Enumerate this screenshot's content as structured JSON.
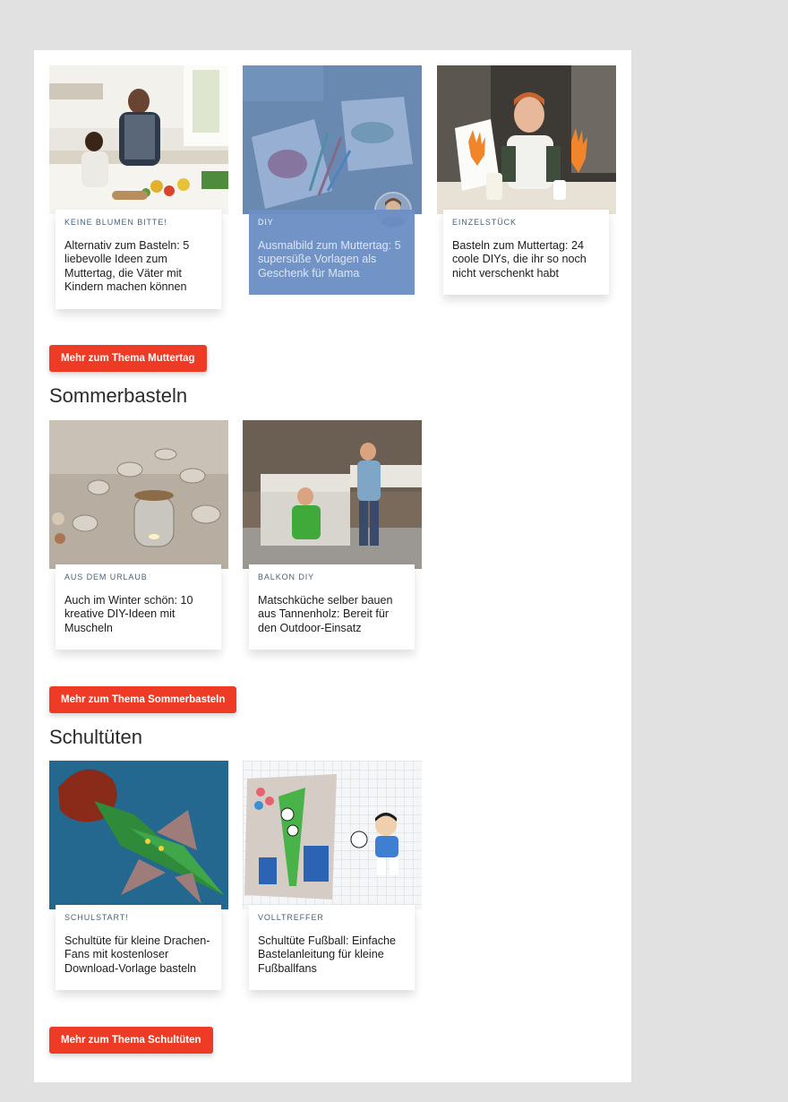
{
  "sections": [
    {
      "heading": "",
      "button_label": "Mehr zum Thema Muttertag",
      "cards": [
        {
          "kicker": "KEINE BLUMEN BITTE!",
          "title": "Alternativ zum Basteln: 5 liebevolle Ideen zum Muttertag, die Väter mit Kindern machen können"
        },
        {
          "kicker": "DIY",
          "title": "Ausmalbild zum Muttertag: 5 supersüße Vorlagen als Geschenk für Mama"
        },
        {
          "kicker": "EINZELSTÜCK",
          "title": "Basteln zum Muttertag: 24 coole DIYs, die ihr so noch nicht verschenkt habt"
        }
      ]
    },
    {
      "heading": "Sommerbasteln",
      "button_label": "Mehr zum Thema Sommerbasteln",
      "cards": [
        {
          "kicker": "AUS DEM URLAUB",
          "title": "Auch im Winter schön: 10 kreative DIY-Ideen mit Muscheln"
        },
        {
          "kicker": "BALKON DIY",
          "title": "Matschküche selber bauen aus Tannenholz: Bereit für den Outdoor-Einsatz"
        }
      ]
    },
    {
      "heading": "Schultüten",
      "button_label": "Mehr zum Thema Schultüten",
      "cards": [
        {
          "kicker": "SCHULSTART!",
          "title": "Schultüte für kleine Drachen-Fans mit kostenloser Download-Vorlage basteln"
        },
        {
          "kicker": "VOLLTREFFER",
          "title": "Schultüte Fußball: Einfache Bastelanleitung für kleine Fußballfans"
        }
      ]
    }
  ],
  "colors": {
    "button_bg": "#ee3b25",
    "page_bg": "#e1e1e1",
    "panel_bg": "#ffffff",
    "kicker": "#4b6275",
    "hover_overlay": "#6c8fc4"
  },
  "icons": []
}
